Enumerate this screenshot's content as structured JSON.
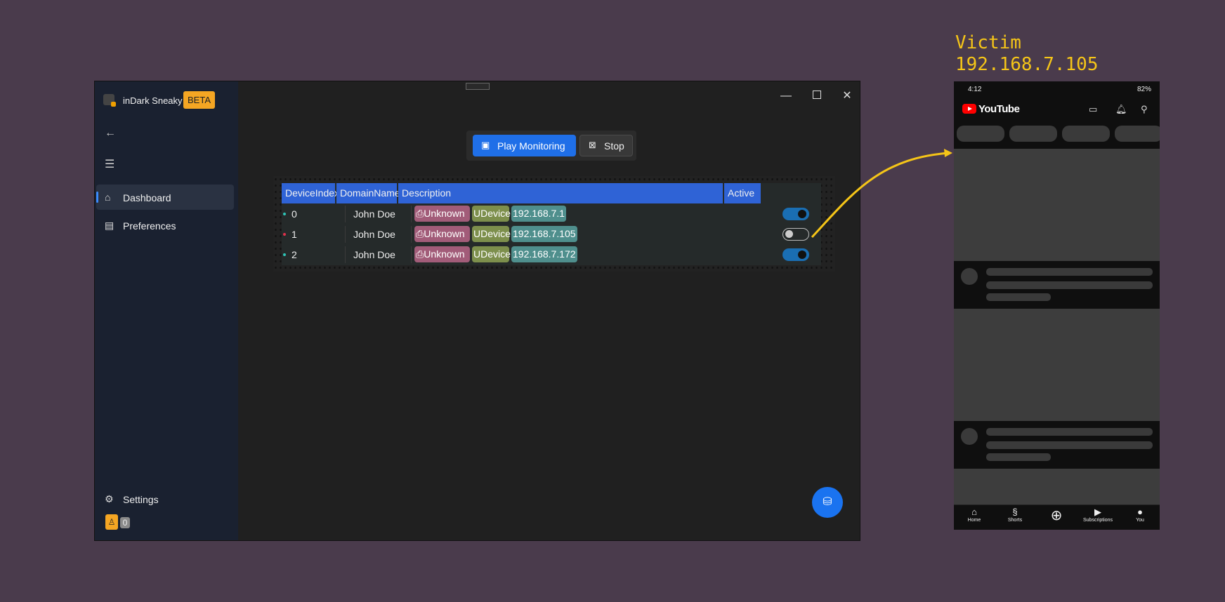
{
  "window": {
    "app_title": "inDark Sneaky",
    "badge": "BETA",
    "controls": {
      "minimize": "—",
      "maximize": "",
      "close": "✕"
    }
  },
  "sidebar": {
    "items": [
      {
        "label": "Dashboard",
        "icon": "home-icon",
        "active": true
      },
      {
        "label": "Preferences",
        "icon": "document-icon",
        "active": false
      }
    ],
    "settings_label": "Settings",
    "footer_count": "0"
  },
  "toolbar": {
    "play_label": "Play Monitoring",
    "stop_label": "Stop"
  },
  "table": {
    "columns": [
      "DeviceIndex",
      "DomainName",
      "Description",
      "Active"
    ],
    "rows": [
      {
        "index": "0",
        "domain": "John Doe",
        "tags": [
          "Unknown",
          "UDevice",
          "192.168.7.1"
        ],
        "active": true,
        "status_color": "#2ec4b6"
      },
      {
        "index": "1",
        "domain": "John Doe",
        "tags": [
          "Unknown",
          "UDevice",
          "192.168.7.105"
        ],
        "active": false,
        "status_color": "#e0314b"
      },
      {
        "index": "2",
        "domain": "John Doe",
        "tags": [
          "Unknown",
          "UDevice",
          "192.168.7.172"
        ],
        "active": true,
        "status_color": "#2ec4b6"
      }
    ]
  },
  "victim": {
    "line1": "Victim",
    "line2": "192.168.7.105"
  },
  "phone": {
    "time": "4:12",
    "battery": "82%",
    "app_name": "YouTube",
    "nav": [
      "Home",
      "Shorts",
      "",
      "Subscriptions",
      "You"
    ]
  },
  "colors": {
    "accent": "#1f6fe8",
    "badge": "#f5a623",
    "arrow": "#f5c518",
    "table_header": "#2f63d6"
  }
}
